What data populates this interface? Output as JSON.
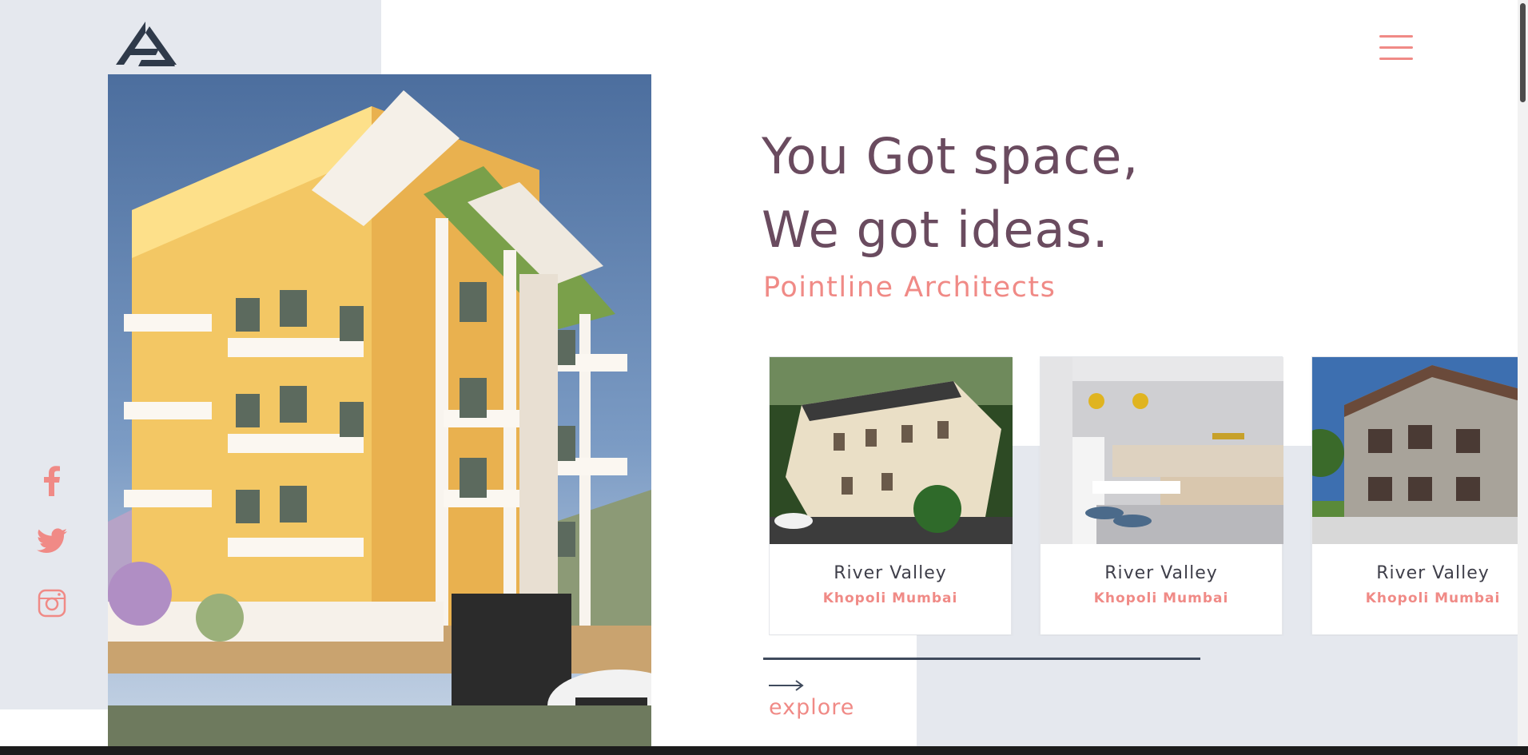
{
  "brand": {
    "logo_icon": "pointline-triangle-logo",
    "logo_color": "#2f3a4a"
  },
  "nav": {
    "menu_icon": "hamburger-menu-icon",
    "menu_color": "#f08a86"
  },
  "hero": {
    "headline_line1": "You Got space,",
    "headline_line2": "We got ideas.",
    "subtitle": "Pointline Architects",
    "headline_color": "#6a4b5f",
    "accent_color": "#f08a86"
  },
  "social": [
    {
      "name": "facebook",
      "icon": "facebook-icon"
    },
    {
      "name": "twitter",
      "icon": "twitter-icon"
    },
    {
      "name": "instagram",
      "icon": "instagram-icon"
    }
  ],
  "projects": [
    {
      "title": "River Valley",
      "location": "Khopoli Mumbai",
      "image": "villa-render"
    },
    {
      "title": "River Valley",
      "location": "Khopoli Mumbai",
      "image": "kitchen-render"
    },
    {
      "title": "River Valley",
      "location": "Khopoli Mumbai",
      "image": "house-render"
    }
  ],
  "explore": {
    "label": "explore",
    "icon": "arrow-right-icon"
  },
  "colors": {
    "panel_grey": "#e5e8ee",
    "dark": "#2f3a4a"
  }
}
